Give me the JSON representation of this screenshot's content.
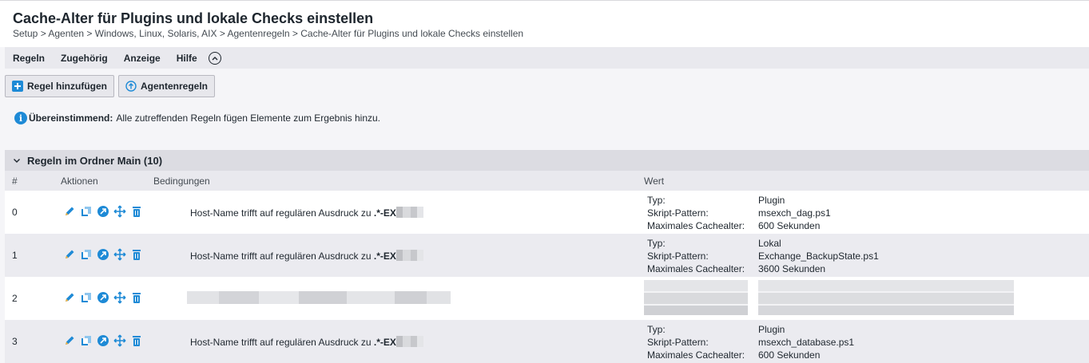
{
  "page": {
    "title": "Cache-Alter für Plugins und lokale Checks einstellen",
    "breadcrumb": "Setup > Agenten > Windows, Linux, Solaris, AIX > Agentenregeln > Cache-Alter für Plugins und lokale Checks einstellen"
  },
  "menu": {
    "items": [
      "Regeln",
      "Zugehörig",
      "Anzeige",
      "Hilfe"
    ]
  },
  "toolbar": {
    "add_rule_label": "Regel hinzufügen",
    "agent_rules_label": "Agentenregeln"
  },
  "info": {
    "bold": "Übereinstimmend:",
    "text": "Alle zutreffenden Regeln fügen Elemente zum Ergebnis hinzu."
  },
  "folder": {
    "title": "Regeln im Ordner Main (10)"
  },
  "columns": {
    "index": "#",
    "actions": "Aktionen",
    "conditions": "Bedingungen",
    "value": "Wert"
  },
  "rows": [
    {
      "index": "0",
      "condition_prefix": "Host-Name trifft auf regulären Ausdruck zu ",
      "condition_regex": ".*-EX",
      "labels": {
        "type": "Typ:",
        "pattern": "Skript-Pattern:",
        "max_age": "Maximales Cachealter:"
      },
      "type": "Plugin",
      "pattern": "msexch_dag.ps1",
      "max_age": "600 Sekunden"
    },
    {
      "index": "1",
      "condition_prefix": "Host-Name trifft auf regulären Ausdruck zu ",
      "condition_regex": ".*-EX",
      "labels": {
        "type": "Typ:",
        "pattern": "Skript-Pattern:",
        "max_age": "Maximales Cachealter:"
      },
      "type": "Lokal",
      "pattern": "Exchange_BackupState.ps1",
      "max_age": "3600 Sekunden"
    },
    {
      "index": "2"
    },
    {
      "index": "3",
      "condition_prefix": "Host-Name trifft auf regulären Ausdruck zu ",
      "condition_regex": ".*-EX",
      "labels": {
        "type": "Typ:",
        "pattern": "Skript-Pattern:",
        "max_age": "Maximales Cachealter:"
      },
      "type": "Plugin",
      "pattern": "msexch_database.ps1",
      "max_age": "600 Sekunden"
    }
  ],
  "icons": {
    "edit": "pencil-icon",
    "clone": "clone-icon",
    "export": "export-icon",
    "move": "move-icon",
    "delete": "trash-icon",
    "add": "plus-icon",
    "agent_rules": "arrow-up-circle-icon",
    "info": "info-icon",
    "collapse": "chevron-up-circle-icon",
    "folder_toggle": "chevron-down-icon"
  },
  "colors": {
    "accent": "#1e8ad6",
    "edit": "#1e8ad6",
    "delete": "#1e8ad6"
  }
}
